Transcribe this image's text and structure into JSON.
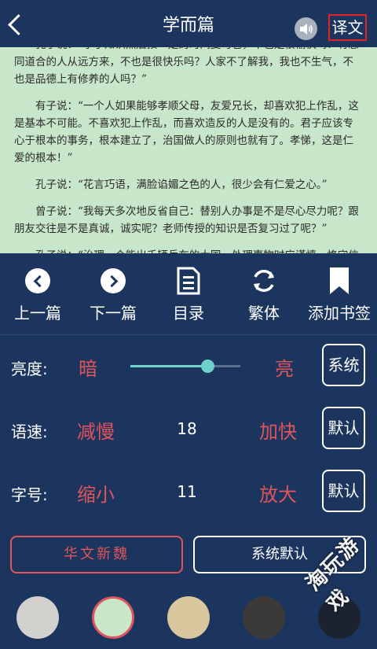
{
  "header": {
    "title": "学而篇",
    "translate_label": "译文",
    "back_icon": "chevron-left-icon",
    "speaker_icon": "speaker-icon"
  },
  "reader": {
    "paragraphs": [
      "孔子说：“学了知识然后按一定的时间复习它，不也是很愉快吗？有志同道合的人从远方来，不也是很快乐吗？人家不了解我，我也不生气，不也是品德上有修养的人吗？”",
      "有子说：“一个人如果能够孝顺父母，友爱兄长，却喜欢犯上作乱，这是基本不可能。不喜欢犯上作乱，而喜欢造反的人是没有的。君子应该专心于根本的事务，根本建立了，治国做人的原则也就有了。孝悌，这是仁爱的根本！”",
      "孔子说：“花言巧语，满脸谄媚之色的人，很少会有仁爱之心。”",
      "曾子说：“我每天多次地反省自己：替别人办事是不是尽心尽力呢？跟朋友交往是不是真诚，诚实呢？老师传授的知识是否复习过了呢？”",
      "孔子说：“治理一个能出千辆兵车的大国，处理事物时应谨慎，恪守信用，诚实无欺，节约财政开支，爱惜百姓，征用民力时，要顾"
    ],
    "background": "#c8e6c9"
  },
  "controls": [
    {
      "label": "上一篇",
      "icon": "previous-chapter-icon"
    },
    {
      "label": "下一篇",
      "icon": "next-chapter-icon"
    },
    {
      "label": "目录",
      "icon": "table-of-contents-icon"
    },
    {
      "label": "繁体",
      "icon": "refresh-icon"
    },
    {
      "label": "添加书签",
      "icon": "bookmark-icon"
    }
  ],
  "brightness": {
    "label": "亮度:",
    "decrease": "暗",
    "increase": "亮",
    "button": "系统",
    "level": 0.7
  },
  "speed": {
    "label": "语速:",
    "decrease": "减慢",
    "value": "18",
    "increase": "加快",
    "button": "默认"
  },
  "fontsize": {
    "label": "字号:",
    "decrease": "缩小",
    "value": "11",
    "increase": "放大",
    "button": "默认"
  },
  "fonts": {
    "option1": "华文新魏",
    "option2": "系统默认"
  },
  "themes": [
    {
      "color": "#d3d1cd",
      "selected": false
    },
    {
      "color": "#c8e6c9",
      "selected": true
    },
    {
      "color": "#d8c79d",
      "selected": false
    },
    {
      "color": "#3b3a39",
      "selected": false
    },
    {
      "color": "#1c2330",
      "selected": false
    }
  ],
  "watermark": "淘玩游戏",
  "colors": {
    "accent": "#e0545c",
    "slider": "#6ed1cc",
    "background": "#1c355e"
  }
}
